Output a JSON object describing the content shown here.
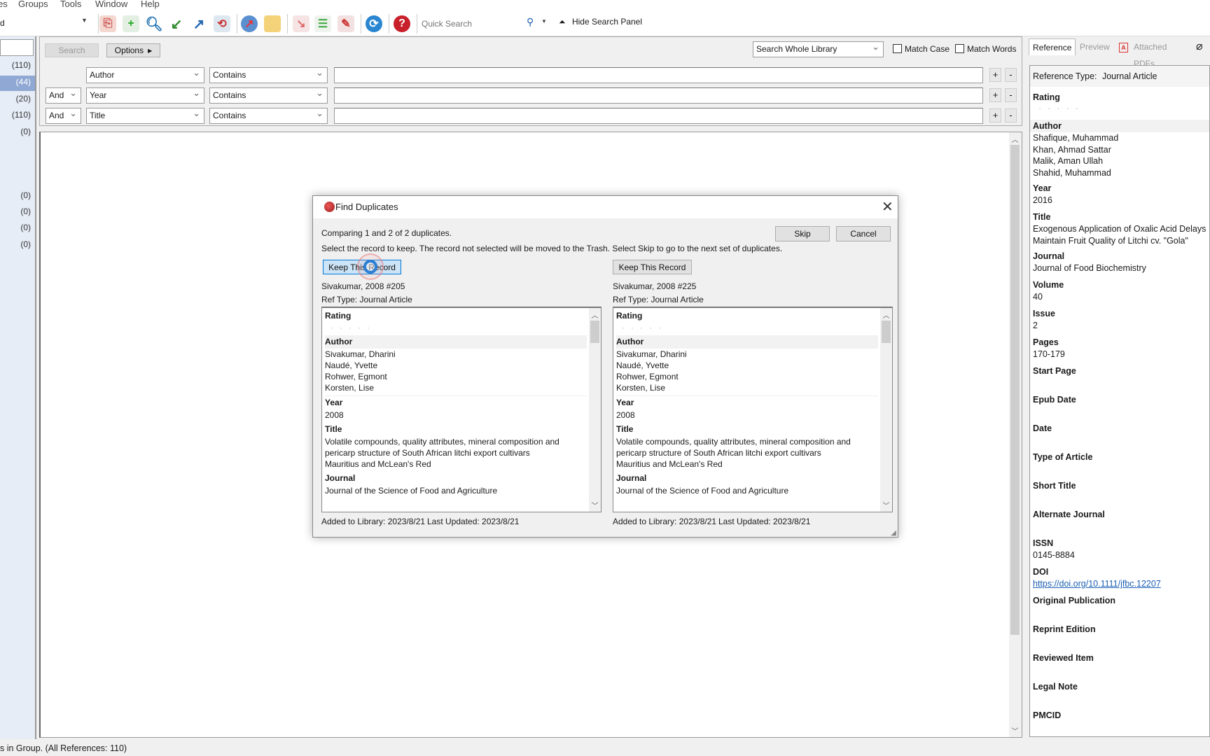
{
  "menu": [
    "es",
    "Groups",
    "Tools",
    "Window",
    "Help"
  ],
  "toolbar": {
    "library_dropdown": "d",
    "icons": [
      "copy-formatted-icon",
      "new-reference-icon",
      "online-search-icon",
      "import-icon",
      "export-icon",
      "find-fulltext-icon",
      "online-library-icon",
      "open-folder-icon",
      "insert-citation-icon",
      "format-bibliography-icon",
      "edit-manuscript-icon",
      "sync-icon",
      "help-icon"
    ],
    "quick_search_placeholder": "Quick Search",
    "hide_search_panel": "Hide Search Panel"
  },
  "sidebar": {
    "counts": [
      "(110)",
      "(44)",
      "(20)",
      "(110)",
      "(0)",
      "(0)",
      "(0)",
      "(0)",
      "(0)"
    ]
  },
  "search": {
    "search_button": "Search",
    "options_button": "Options",
    "scope": "Search Whole Library",
    "match_case": "Match Case",
    "match_words": "Match Words",
    "rows": [
      {
        "bool": "",
        "field": "Author",
        "op": "Contains",
        "value": ""
      },
      {
        "bool": "And",
        "field": "Year",
        "op": "Contains",
        "value": ""
      },
      {
        "bool": "And",
        "field": "Title",
        "op": "Contains",
        "value": ""
      }
    ]
  },
  "status_bar": "s in Group. (All References: 110)",
  "right_panel": {
    "tabs": [
      "Reference",
      "Preview",
      "Attached PDFs"
    ],
    "ref_type_label": "Reference Type:",
    "ref_type": "Journal Article",
    "fields": [
      {
        "label": "Rating",
        "value": [],
        "stars": 5
      },
      {
        "label": "Author",
        "value": [
          "Shafique, Muhammad",
          "Khan, Ahmad Sattar",
          "Malik, Aman Ullah",
          "Shahid, Muhammad"
        ]
      },
      {
        "label": "Year",
        "value": [
          "2016"
        ]
      },
      {
        "label": "Title",
        "value": [
          "Exogenous Application of Oxalic Acid Delays",
          "Maintain Fruit Quality of Litchi cv. \"Gola\""
        ]
      },
      {
        "label": "Journal",
        "value": [
          "Journal of Food Biochemistry"
        ]
      },
      {
        "label": "Volume",
        "value": [
          "40"
        ]
      },
      {
        "label": "Issue",
        "value": [
          "2"
        ]
      },
      {
        "label": "Pages",
        "value": [
          "170-179"
        ]
      },
      {
        "label": "Start Page",
        "value": []
      },
      {
        "label": "Epub Date",
        "value": []
      },
      {
        "label": "Date",
        "value": []
      },
      {
        "label": "Type of Article",
        "value": []
      },
      {
        "label": "Short Title",
        "value": []
      },
      {
        "label": "Alternate Journal",
        "value": []
      },
      {
        "label": "ISSN",
        "value": [
          "0145-8884"
        ]
      },
      {
        "label": "DOI",
        "value": [
          "https://doi.org/10.1111/jfbc.12207"
        ],
        "link": true
      },
      {
        "label": "Original Publication",
        "value": []
      },
      {
        "label": "Reprint Edition",
        "value": []
      },
      {
        "label": "Reviewed Item",
        "value": []
      },
      {
        "label": "Legal Note",
        "value": []
      },
      {
        "label": "PMCID",
        "value": []
      }
    ]
  },
  "dialog": {
    "title": "Find Duplicates",
    "comparing": "Comparing 1 and 2 of 2 duplicates.",
    "instructions": "Select the record to keep. The record not selected will be moved to the Trash. Select Skip to go to the next set of duplicates.",
    "skip": "Skip",
    "cancel": "Cancel",
    "records": [
      {
        "keep": "Keep This Record",
        "label": "Sivakumar, 2008 #205",
        "ref_type": "Ref Type: Journal Article",
        "rating_label": "Rating",
        "author_label": "Author",
        "authors": [
          "Sivakumar, Dharini",
          "Naudé, Yvette",
          "Rohwer, Egmont",
          "Korsten, Lise"
        ],
        "year_label": "Year",
        "year": "2008",
        "title_label": "Title",
        "title": [
          "Volatile compounds, quality attributes, mineral composition and",
          "pericarp structure of South African litchi export cultivars",
          "Mauritius and McLean's Red"
        ],
        "journal_label": "Journal",
        "journal": "Journal of the Science of Food and Agriculture",
        "added": "Added to Library: 2023/8/21",
        "updated": "Last Updated: 2023/8/21"
      },
      {
        "keep": "Keep This Record",
        "label": "Sivakumar, 2008 #225",
        "ref_type": "Ref Type: Journal Article",
        "rating_label": "Rating",
        "author_label": "Author",
        "authors": [
          "Sivakumar, Dharini",
          "Naudé, Yvette",
          "Rohwer, Egmont",
          "Korsten, Lise"
        ],
        "year_label": "Year",
        "year": "2008",
        "title_label": "Title",
        "title": [
          "Volatile compounds, quality attributes, mineral composition and",
          "pericarp structure of South African litchi export cultivars",
          "Mauritius and McLean's Red"
        ],
        "journal_label": "Journal",
        "journal": "Journal of the Science of Food and Agriculture",
        "added": "Added to Library: 2023/8/21",
        "updated": "Last Updated: 2023/8/21"
      }
    ]
  },
  "colors": {
    "selection": "#c5d7ef",
    "link": "#1a5fb4",
    "sidebar_bg": "#e6edf7",
    "cursor": "#2a7fd4"
  }
}
